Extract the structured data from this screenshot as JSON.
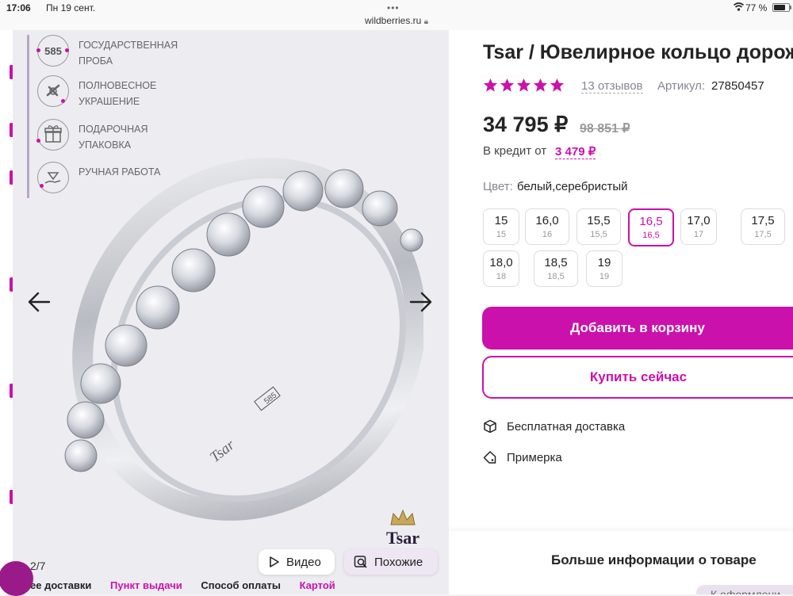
{
  "status_bar": {
    "time": "17:06",
    "date": "Пн 19 сент.",
    "dots": "•••",
    "url": "wildberries.ru",
    "battery": "77 %",
    "battery_level": 0.77
  },
  "gallery": {
    "badges": [
      {
        "label": "ГОСУДАРСТВЕННАЯ\nПРОБА",
        "icon": "hallmark-585-icon",
        "icon_text": "585"
      },
      {
        "label": "ПОЛНОВЕСНОЕ\nУКРАШЕНИЕ",
        "icon": "weight-icon"
      },
      {
        "label": "ПОДАРОЧНАЯ\nУПАКОВКА",
        "icon": "gift-box-icon"
      },
      {
        "label": "РУЧНАЯ РАБОТА",
        "icon": "hand-diamond-icon"
      }
    ],
    "counter": "2/7",
    "video_label": "Видео",
    "similar_label": "Похожие",
    "logo_text": "Tsar",
    "engraving": "Tsar",
    "bottom_menu": [
      "ее доставки",
      "Пункт выдачи",
      "Способ оплаты",
      "Картой"
    ]
  },
  "product": {
    "title": "Tsar / Ювелирное кольцо дорож",
    "rating": 5,
    "reviews": "13 отзывов",
    "sku_label": "Артикул:",
    "sku_value": "27850457",
    "price": "34 795 ₽",
    "old_price": "98 851 ₽",
    "credit_label": "В кредит от",
    "credit_value": "3 479 ₽",
    "color_label": "Цвет:",
    "color_value": "белый,серебристый",
    "sizes": [
      {
        "num": "15",
        "sub": "15",
        "selected": false
      },
      {
        "num": "16,0",
        "sub": "16",
        "selected": false
      },
      {
        "num": "15,5",
        "sub": "15,5",
        "selected": false
      },
      {
        "num": "16,5",
        "sub": "16,5",
        "selected": true
      },
      {
        "num": "17,0",
        "sub": "17",
        "selected": false
      },
      {
        "num": "17,5",
        "sub": "17,5",
        "selected": false
      },
      {
        "num": "18,0",
        "sub": "18",
        "selected": false
      },
      {
        "num": "18,5",
        "sub": "18,5",
        "selected": false
      },
      {
        "num": "19",
        "sub": "19",
        "selected": false
      }
    ],
    "add_to_cart": "Добавить в корзину",
    "buy_now": "Купить сейчас",
    "features": [
      {
        "label": "Бесплатная доставка",
        "icon": "box-icon"
      },
      {
        "label": "Примерка",
        "icon": "tag-icon"
      }
    ],
    "more_info": "Больше информации о товаре",
    "checkout": "К оформлени"
  },
  "colors": {
    "accent": "#cb11ab",
    "text": "#242424",
    "muted": "#868695"
  }
}
